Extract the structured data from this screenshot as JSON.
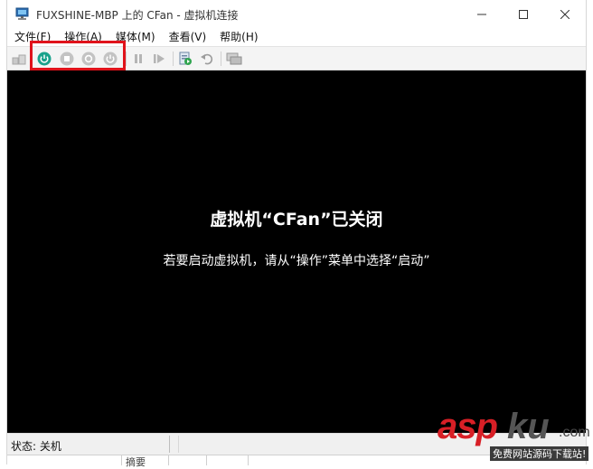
{
  "window": {
    "title": "FUXSHINE-MBP 上的 CFan - 虚拟机连接",
    "icon": "vm-connection-icon"
  },
  "menu": [
    {
      "label": "文件(F)"
    },
    {
      "label": "操作(A)"
    },
    {
      "label": "媒体(M)"
    },
    {
      "label": "查看(V)"
    },
    {
      "label": "帮助(H)"
    }
  ],
  "toolbar": {
    "highlight_color": "#e0131b",
    "start_color": "#1aa28c",
    "buttons": [
      "ctrl-alt-del-icon",
      "start-icon",
      "turn-off-icon",
      "shut-down-icon",
      "save-icon",
      "pause-icon",
      "resume-icon",
      "checkpoint-icon",
      "revert-icon",
      "enhanced-session-icon"
    ]
  },
  "screen": {
    "background": "#000000",
    "title": "虚拟机“CFan”已关闭",
    "hint": "若要启动虚拟机，请从“操作”菜单中选择“启动”"
  },
  "status": {
    "label": "状态: 关机"
  },
  "underbar": {
    "text": "摘要"
  },
  "watermark": {
    "asp": "asp",
    "ku": "ku",
    "com": ".com",
    "sub": "免费网站源码下载站!"
  }
}
